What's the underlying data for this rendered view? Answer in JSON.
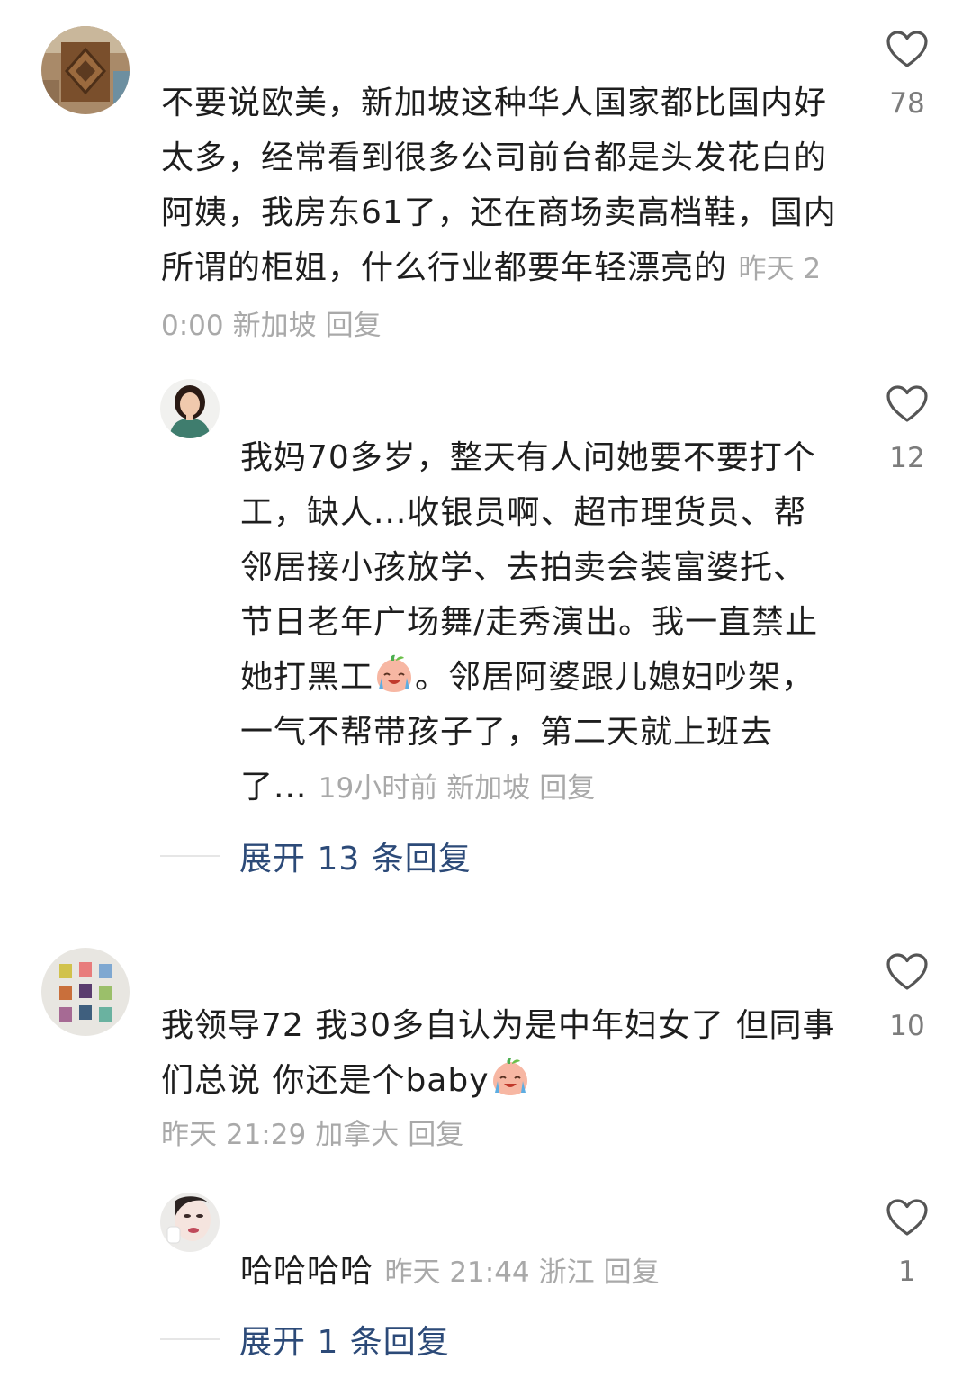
{
  "comments": [
    {
      "text": "不要说欧美，新加坡这种华人国家都比国内好太多，经常看到很多公司前台都是头发花白的阿姨，我房东61了，还在商场卖高档鞋，国内所谓的柜姐，什么行业都要年轻漂亮的",
      "time": "昨天 20:00",
      "location": "新加坡",
      "reply_label": "回复",
      "likes": "78"
    },
    {
      "text_before_emoji": "我妈70多岁，整天有人问她要不要打个工，缺人...收银员啊、超市理货员、帮邻居接小孩放学、去拍卖会装富婆托、节日老年广场舞/走秀演出。我一直禁止她打黑工",
      "text_after_emoji": "。邻居阿婆跟儿媳妇吵架，一气不帮带孩子了，第二天就上班去了...",
      "time": "19小时前",
      "location": "新加坡",
      "reply_label": "回复",
      "likes": "12",
      "emoji": "crying-laughing-peach-emoji"
    },
    {
      "text_before_emoji": "我领导72 我30多自认为是中年妇女了 但同事们总说 你还是个baby",
      "time": "昨天 21:29",
      "location": "加拿大",
      "reply_label": "回复",
      "likes": "10",
      "emoji": "crying-laughing-peach-emoji"
    },
    {
      "text": "哈哈哈哈",
      "time": "昨天 21:44",
      "location": "浙江",
      "reply_label": "回复",
      "likes": "1"
    }
  ],
  "expand_replies": [
    {
      "label": "展开 13 条回复"
    },
    {
      "label": "展开 1 条回复"
    }
  ],
  "icons": {
    "like": "heart-outline-icon"
  },
  "colors": {
    "link": "#2c4a78",
    "meta": "#a9a9a9",
    "like_stroke": "#555555"
  }
}
